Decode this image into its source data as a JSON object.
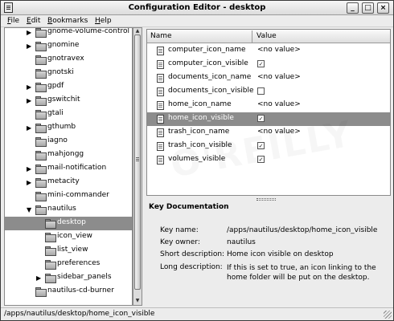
{
  "window": {
    "title": "Configuration Editor - desktop",
    "controls": {
      "minimize": "_",
      "maximize": "□",
      "close": "×"
    }
  },
  "menubar": {
    "items": [
      {
        "label_mnemonic": "F",
        "label_rest": "ile"
      },
      {
        "label_mnemonic": "E",
        "label_rest": "dit"
      },
      {
        "label_mnemonic": "B",
        "label_rest": "ookmarks"
      },
      {
        "label_mnemonic": "H",
        "label_rest": "elp"
      }
    ]
  },
  "tree": {
    "items": [
      {
        "label": "gnome-volume-control",
        "expander": "▶"
      },
      {
        "label": "gnomine",
        "expander": "▶"
      },
      {
        "label": "gnotravex",
        "expander": ""
      },
      {
        "label": "gnotski",
        "expander": ""
      },
      {
        "label": "gpdf",
        "expander": "▶"
      },
      {
        "label": "gswitchit",
        "expander": "▶"
      },
      {
        "label": "gtali",
        "expander": ""
      },
      {
        "label": "gthumb",
        "expander": "▶"
      },
      {
        "label": "iagno",
        "expander": ""
      },
      {
        "label": "mahjongg",
        "expander": ""
      },
      {
        "label": "mail-notification",
        "expander": "▶"
      },
      {
        "label": "metacity",
        "expander": "▶"
      },
      {
        "label": "mini-commander",
        "expander": ""
      },
      {
        "label": "nautilus",
        "expander": "▼"
      },
      {
        "label": "desktop",
        "expander": ""
      },
      {
        "label": "icon_view",
        "expander": ""
      },
      {
        "label": "list_view",
        "expander": ""
      },
      {
        "label": "preferences",
        "expander": ""
      },
      {
        "label": "sidebar_panels",
        "expander": "▶"
      },
      {
        "label": "nautilus-cd-burner",
        "expander": ""
      }
    ]
  },
  "keys_table": {
    "headers": {
      "name": "Name",
      "value": "Value"
    },
    "rows": [
      {
        "name": "computer_icon_name",
        "value": "<no value>",
        "checkbox": ""
      },
      {
        "name": "computer_icon_visible",
        "value": "",
        "checkbox": "✓"
      },
      {
        "name": "documents_icon_name",
        "value": "<no value>",
        "checkbox": ""
      },
      {
        "name": "documents_icon_visible",
        "value": "",
        "checkbox": ""
      },
      {
        "name": "home_icon_name",
        "value": "<no value>",
        "checkbox": ""
      },
      {
        "name": "home_icon_visible",
        "value": "",
        "checkbox": "✓"
      },
      {
        "name": "trash_icon_name",
        "value": "<no value>",
        "checkbox": ""
      },
      {
        "name": "trash_icon_visible",
        "value": "",
        "checkbox": "✓"
      },
      {
        "name": "volumes_visible",
        "value": "",
        "checkbox": "✓"
      }
    ]
  },
  "key_documentation": {
    "title": "Key Documentation",
    "key_name_label": "Key name:",
    "key_name_value": "/apps/nautilus/desktop/home_icon_visible",
    "key_owner_label": "Key owner:",
    "key_owner_value": "nautilus",
    "short_desc_label": "Short description:",
    "short_desc_value": "Home icon visible on desktop",
    "long_desc_label": "Long description:",
    "long_desc_value": "If this is set to true, an icon linking to the home folder will be put on the desktop."
  },
  "statusbar": {
    "path": "/apps/nautilus/desktop/home_icon_visible"
  },
  "watermark": "O'REILLY"
}
